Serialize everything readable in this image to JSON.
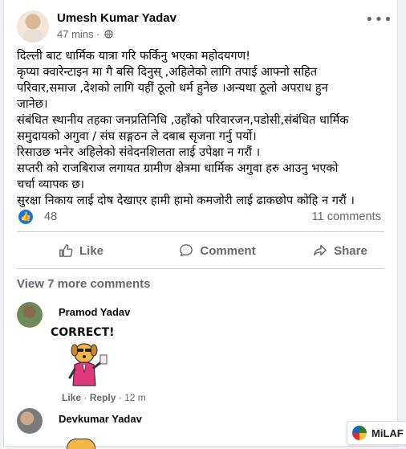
{
  "post": {
    "author": "Umesh Kumar Yadav",
    "time": "47 mins ·",
    "lines": [
      "दिल्ली बाट धार्मिक यात्रा गरि फर्किनु भएका महोदयगण!",
      "कृप्या क्वारेन्टाइन मा गै बसि दिनुस् ,अहिलेको लागि तपाई आफ्नो सहित",
      "परिवार,समाज ,देशको लागि यहीं ठूलो धर्म हुनेछ ।अन्यथा ठूलो अपराध हुन",
      "जानेछ।",
      "संबंधित स्थानीय तहका जनप्रतिनिधि ,उहाँको परिवारजन,पडोसी,संबंधित धार्मिक",
      "समुदायको अगुवा / संघ सङ्गठन ले दबाब सृजना गर्नु पर्यो।",
      "रिसाउछ भनेर अहिलेको संवेदनशिलता लाई उपेक्षा  न गरौं ।",
      "सप्तरी को राजबिराज लगायत ग्रामीण क्षेत्रमा धार्मिक अगुवा हरु आउनु भएको",
      "चर्चा व्यापक छ।",
      "सुरक्षा निकाय लाई दोष देखाएर हामी हामो कमजोरी लाई ढाकछोप कोहि न गरौं ।"
    ],
    "likes": "48",
    "comments": "11 comments",
    "actions": {
      "like": "Like",
      "comment": "Comment",
      "share": "Share"
    },
    "view_more": "View 7 more comments"
  },
  "comments": [
    {
      "name": "Pramod Yadav",
      "sticker_text": "CORRECT!",
      "like_label": "Like",
      "reply_label": "Reply",
      "time": "12 m"
    },
    {
      "name": "Devkumar Yadav"
    }
  ],
  "overlay": {
    "label": "MiLAF"
  },
  "colors": {
    "accent": "#1b74e4",
    "muted": "#65676b",
    "background": "#f0f2f5"
  }
}
